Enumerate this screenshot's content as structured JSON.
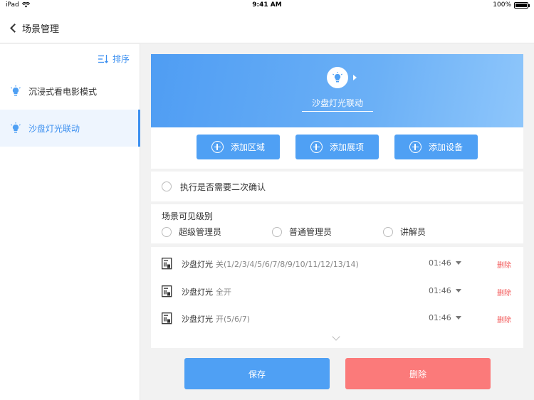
{
  "status_bar": {
    "carrier": "iPad",
    "time": "9:41 AM",
    "battery": "100%"
  },
  "nav": {
    "title": "场景管理"
  },
  "sidebar": {
    "sort_label": "排序",
    "items": [
      {
        "label": "沉浸式看电影模式"
      },
      {
        "label": "沙盘灯光联动"
      }
    ]
  },
  "scene": {
    "name": "沙盘灯光联动",
    "add_buttons": [
      "添加区域",
      "添加展项",
      "添加设备"
    ],
    "confirm_label": "执行是否需要二次确认",
    "visibility_label": "场景可见级别",
    "visibility_options": [
      "超级管理员",
      "普通管理员",
      "讲解员"
    ],
    "devices": [
      {
        "name": "沙盘灯光",
        "state": "关(1/2/3/4/5/6/7/8/9/10/11/12/13/14)",
        "time": "01:46",
        "delete": "删除"
      },
      {
        "name": "沙盘灯光",
        "state": "全开",
        "time": "01:46",
        "delete": "删除"
      },
      {
        "name": "沙盘灯光",
        "state": "开(5/6/7)",
        "time": "01:46",
        "delete": "删除"
      }
    ]
  },
  "footer": {
    "save": "保存",
    "delete": "删除"
  },
  "colors": {
    "accent": "#4fa0f4",
    "danger": "#fb7a7a",
    "delete_text": "#f25a5a"
  }
}
